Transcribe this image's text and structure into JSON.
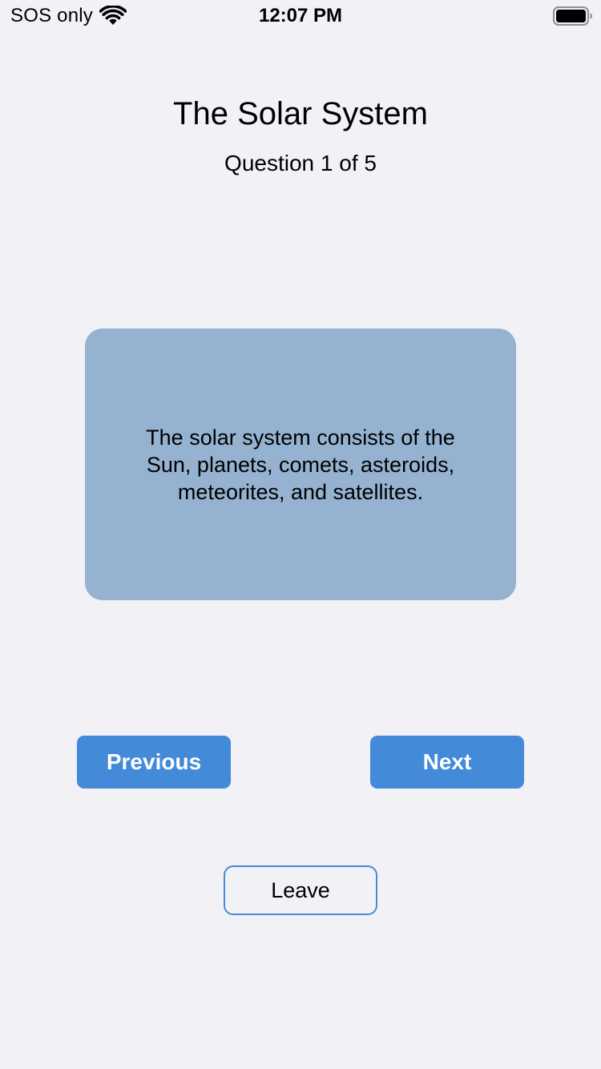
{
  "status_bar": {
    "carrier": "SOS only",
    "time": "12:07 PM",
    "wifi_icon": "wifi-icon",
    "battery_icon": "battery-full-icon"
  },
  "header": {
    "title": "The Solar System",
    "progress": "Question 1 of 5"
  },
  "card": {
    "text": "The solar system consists of the Sun, planets, comets, asteroids, meteorites, and satellites.",
    "background": "#95b2d0"
  },
  "navigation": {
    "previous_label": "Previous",
    "next_label": "Next",
    "leave_label": "Leave"
  },
  "colors": {
    "accent": "#438ad9",
    "background": "#f2f1f6"
  }
}
